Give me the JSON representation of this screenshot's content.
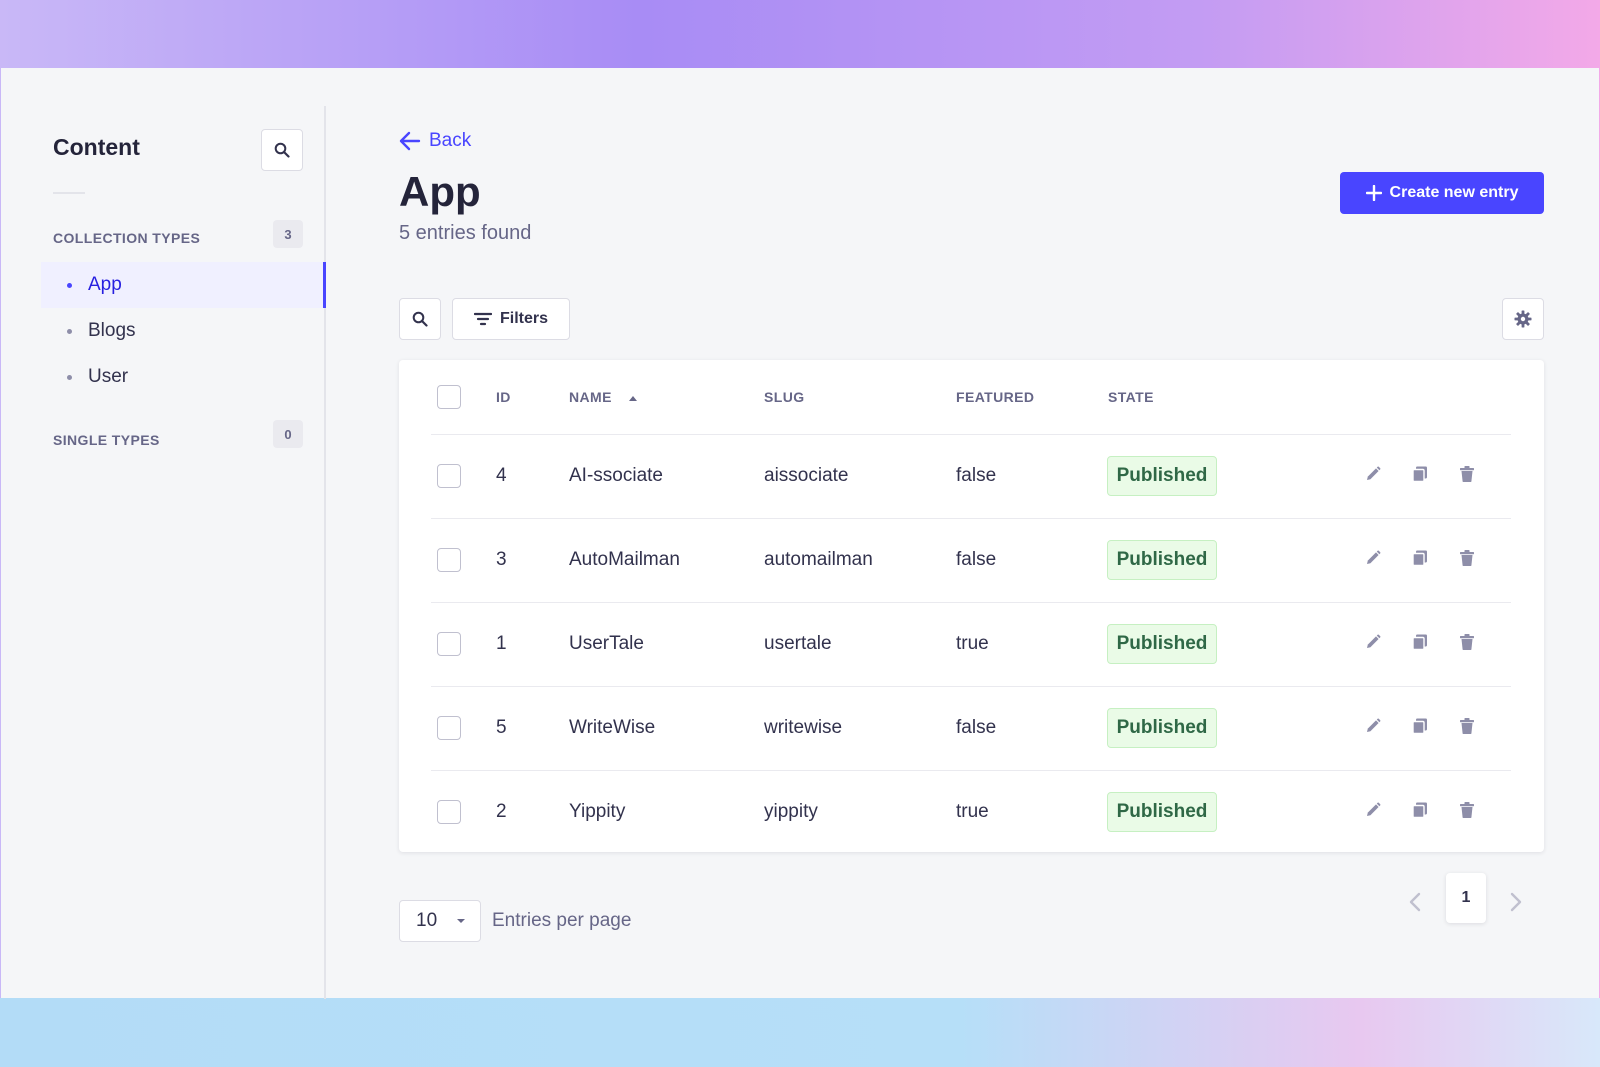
{
  "sidebar": {
    "title": "Content",
    "collection_types_label": "COLLECTION TYPES",
    "collection_types_count": "3",
    "items": [
      {
        "label": "App"
      },
      {
        "label": "Blogs"
      },
      {
        "label": "User"
      }
    ],
    "single_types_label": "SINGLE TYPES",
    "single_types_count": "0"
  },
  "header": {
    "back_label": "Back",
    "title": "App",
    "subtitle": "5 entries found",
    "create_label": "Create new entry"
  },
  "toolbar": {
    "filters_label": "Filters"
  },
  "table": {
    "columns": [
      "ID",
      "NAME",
      "SLUG",
      "FEATURED",
      "STATE"
    ],
    "rows": [
      {
        "id": "4",
        "name": "AI-ssociate",
        "slug": "aissociate",
        "featured": "false",
        "state": "Published"
      },
      {
        "id": "3",
        "name": "AutoMailman",
        "slug": "automailman",
        "featured": "false",
        "state": "Published"
      },
      {
        "id": "1",
        "name": "UserTale",
        "slug": "usertale",
        "featured": "true",
        "state": "Published"
      },
      {
        "id": "5",
        "name": "WriteWise",
        "slug": "writewise",
        "featured": "false",
        "state": "Published"
      },
      {
        "id": "2",
        "name": "Yippity",
        "slug": "yippity",
        "featured": "true",
        "state": "Published"
      }
    ]
  },
  "pagination": {
    "per_page_value": "10",
    "per_page_label": "Entries per page",
    "current_page": "1"
  },
  "colors": {
    "accent": "#4945ff",
    "published_bg": "#eafbe7",
    "published_text": "#2f6846"
  },
  "icons": [
    "search-icon",
    "arrow-left-icon",
    "plus-icon",
    "filter-icon",
    "gear-icon",
    "sort-up-icon",
    "pencil-icon",
    "duplicate-icon",
    "trash-icon",
    "chevron-down-icon",
    "chevron-left-icon",
    "chevron-right-icon"
  ]
}
